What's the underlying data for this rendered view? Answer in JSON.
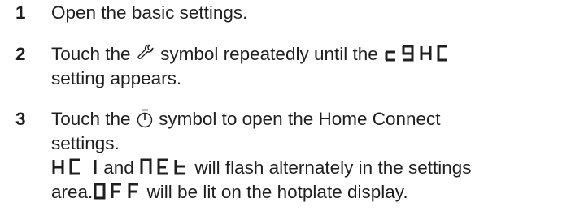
{
  "steps": [
    {
      "number": "1",
      "text": "Open the basic settings."
    },
    {
      "number": "2",
      "line1_before": "Touch the",
      "icon_1": "wrench-icon",
      "line1_middle": "symbol repeatedly until the",
      "display_code_1": "c9HC",
      "line2": "setting appears."
    },
    {
      "number": "3",
      "line1_before": "Touch the",
      "icon_2": "timer-icon",
      "line1_after": "symbol to open the Home Connect",
      "line2": "settings.",
      "display_code_hc1": "HC 1",
      "line3_and": "and",
      "display_code_net": "NEt",
      "line3_after": "will flash alternately in the settings",
      "line4_before": "area.",
      "display_code_off": "OFF",
      "line4_after": "will be lit on the hotplate display."
    }
  ]
}
